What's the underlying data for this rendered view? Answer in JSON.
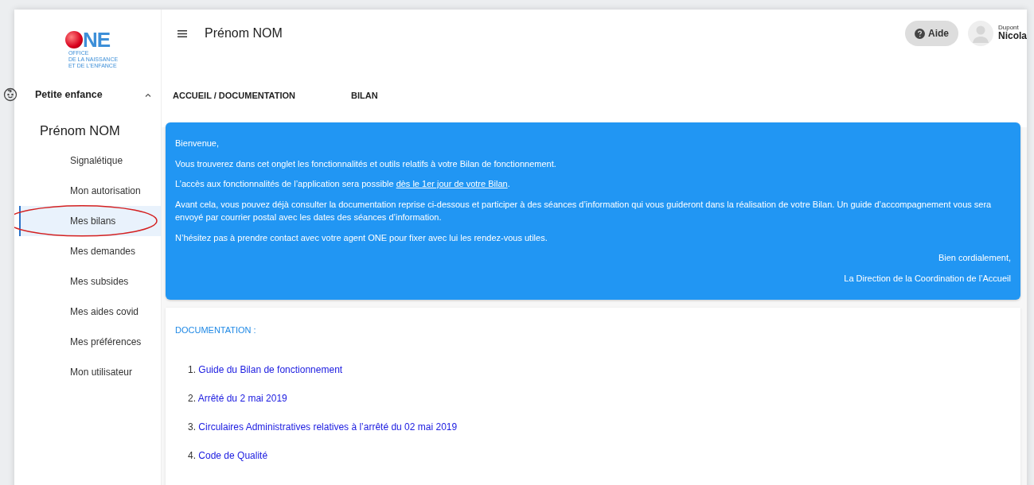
{
  "logo": {
    "letters": "NE",
    "subtitle": [
      "OFFICE",
      "DE LA NAISSANCE",
      "ET DE L'ENFANCE"
    ]
  },
  "header": {
    "title": "Prénom NOM",
    "help_button": "Aide",
    "user": {
      "last_name": "Dupont",
      "first_name": "Nicola"
    }
  },
  "sidebar": {
    "section": {
      "label": "Petite enfance",
      "expanded": true
    },
    "person": "Prénom NOM",
    "items": [
      {
        "label": "Signalétique",
        "selected": false
      },
      {
        "label": "Mon autorisation",
        "selected": false
      },
      {
        "label": "Mes bilans",
        "selected": true
      },
      {
        "label": "Mes demandes",
        "selected": false
      },
      {
        "label": "Mes subsides",
        "selected": false
      },
      {
        "label": "Mes aides covid",
        "selected": false
      },
      {
        "label": "Mes préférences",
        "selected": false
      },
      {
        "label": "Mon utilisateur",
        "selected": false
      }
    ]
  },
  "breadcrumb": {
    "path": "ACCUEIL / DOCUMENTATION",
    "current": "BILAN"
  },
  "welcome": {
    "paragraphs": [
      {
        "text": "Bienvenue,"
      },
      {
        "text": "Vous trouverez dans cet onglet les fonctionnalités et outils relatifs à votre Bilan de fonctionnement."
      },
      {
        "text": "L’accès aux fonctionnalités de l’application sera possible ",
        "link": "dès le 1er jour de votre Bilan",
        "after": "."
      },
      {
        "text": "Avant cela, vous pouvez déjà consulter la documentation reprise ci-dessous et participer à des séances d’information qui vous guideront dans la réalisation de votre Bilan. Un guide d’accompagnement vous sera envoyé par courrier postal avec les dates des séances d’information."
      },
      {
        "text": "N’hésitez pas à prendre contact avec votre agent ONE pour fixer avec lui les rendez-vous utiles."
      }
    ],
    "closing": "Bien cordialement,",
    "signature": "La Direction de la Coordination de l’Accueil"
  },
  "documentation": {
    "title": "DOCUMENTATION :",
    "links": [
      {
        "number": "1.",
        "label": "Guide du Bilan de fonctionnement"
      },
      {
        "number": "2.",
        "label": "Arrêté du 2 mai 2019"
      },
      {
        "number": "3.",
        "label": "Circulaires Administratives relatives à l’arrêté du 02 mai 2019"
      },
      {
        "number": "4.",
        "label": "Code de Qualité"
      }
    ]
  }
}
